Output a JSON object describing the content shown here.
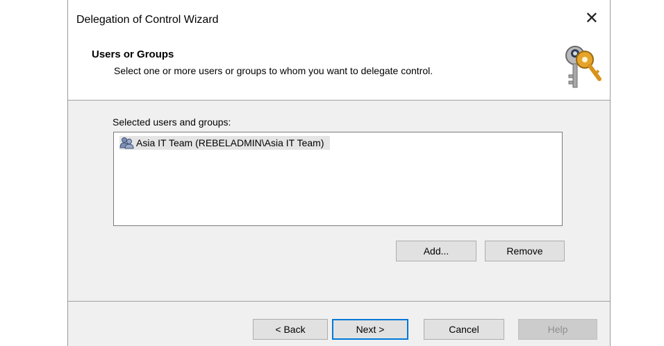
{
  "window": {
    "title": "Delegation of Control Wizard"
  },
  "header": {
    "title": "Users or Groups",
    "subtitle": "Select one or more users or groups to whom you want to delegate control."
  },
  "content": {
    "list_label": "Selected users and groups:",
    "items": [
      {
        "label": "Asia IT Team (REBELADMIN\\Asia IT Team)",
        "icon": "group-icon",
        "selected": true
      }
    ],
    "add_label": "Add...",
    "remove_label": "Remove"
  },
  "footer": {
    "back_label": "< Back",
    "next_label": "Next >",
    "cancel_label": "Cancel",
    "help_label": "Help"
  },
  "colors": {
    "focus_border": "#0078d7",
    "panel_background": "#f0f0f0"
  }
}
